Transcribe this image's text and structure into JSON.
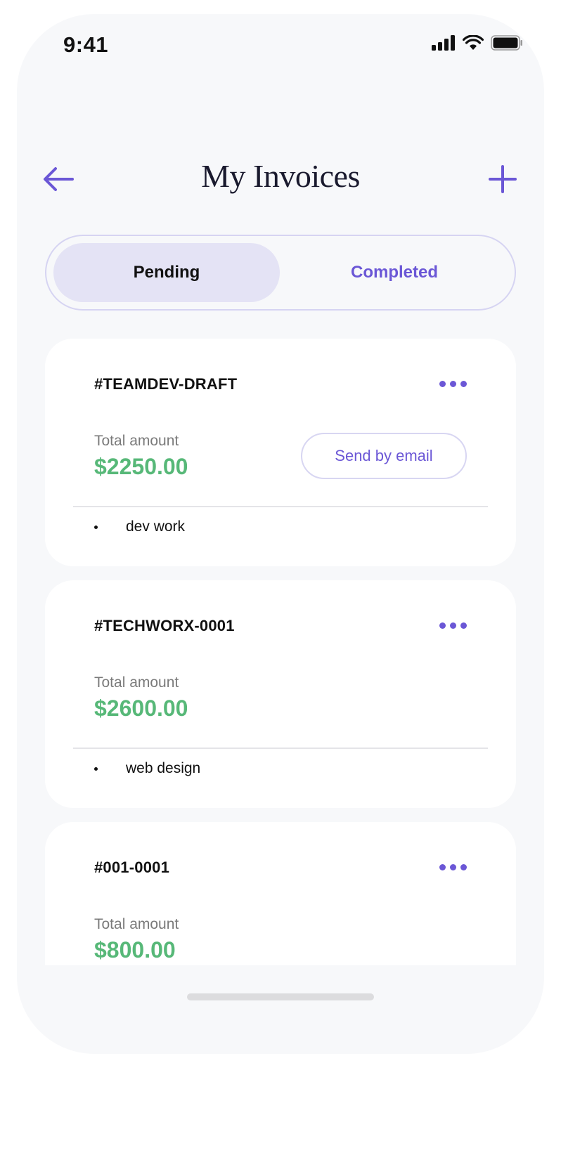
{
  "status_bar": {
    "time": "9:41"
  },
  "header": {
    "title": "My Invoices",
    "back_icon": "arrow-left-icon",
    "add_icon": "plus-icon"
  },
  "tabs": [
    {
      "label": "Pending",
      "active": true
    },
    {
      "label": "Completed",
      "active": false
    }
  ],
  "invoices": [
    {
      "id": "#TEAMDEV-DRAFT",
      "amount_label": "Total amount",
      "amount": "$2250.00",
      "action_label": "Send by email",
      "items": [
        "dev work"
      ]
    },
    {
      "id": "#TECHWORX-0001",
      "amount_label": "Total amount",
      "amount": "$2600.00",
      "items": [
        "web design"
      ]
    },
    {
      "id": "#001-0001",
      "amount_label": "Total amount",
      "amount": "$800.00",
      "items": []
    }
  ],
  "colors": {
    "accent": "#6b57d6",
    "amount": "#57b878",
    "background": "#f7f8fa",
    "tab_active": "#e4e3f5"
  }
}
